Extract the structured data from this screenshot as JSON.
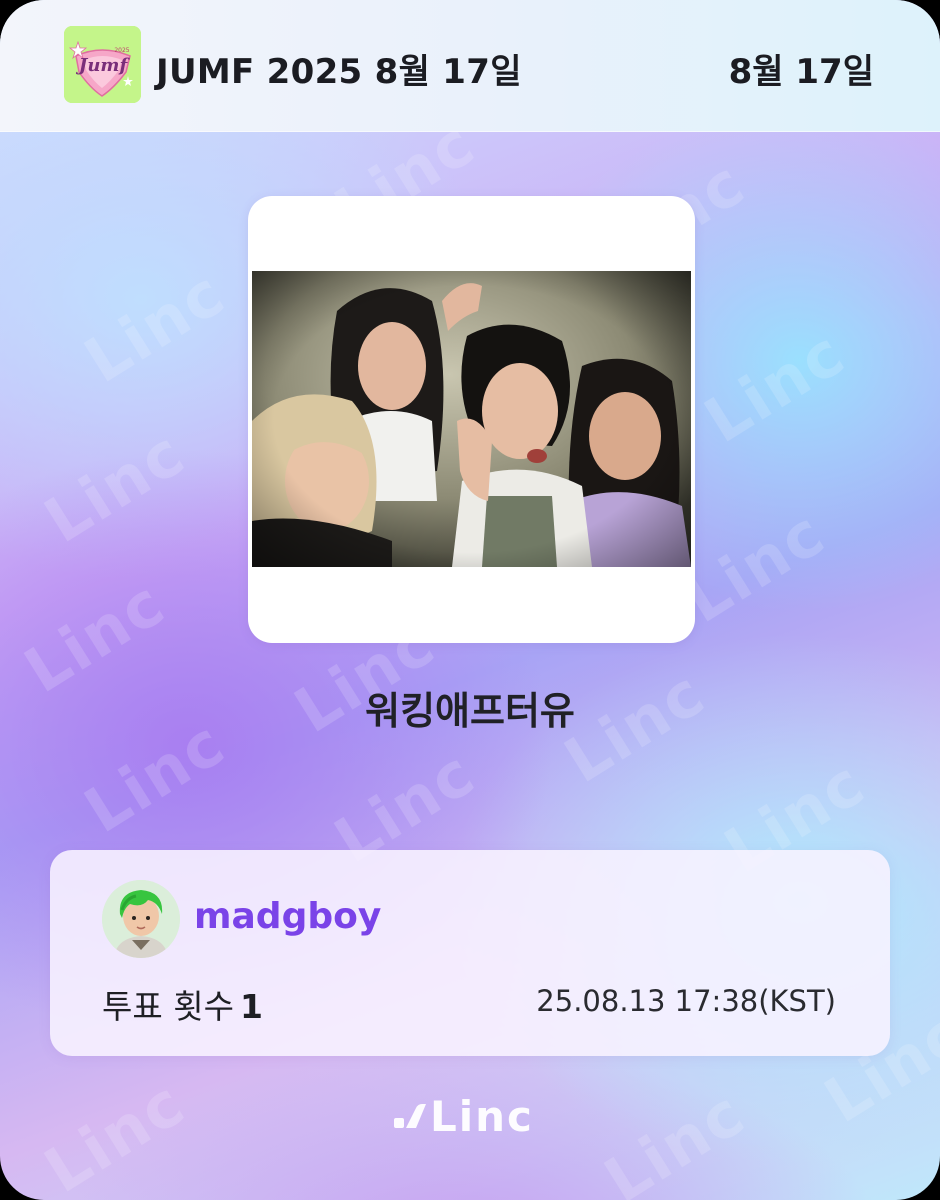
{
  "header": {
    "title": "JUMF 2025 8월 17일",
    "date": "8월 17일",
    "logo_text": "Jumf",
    "logo_year": "2025"
  },
  "artist": {
    "name": "워킹애프터유",
    "photo_icon": "group-photo"
  },
  "vote": {
    "username": "madgboy",
    "count_label": "투표 횟수",
    "count_value": "1",
    "timestamp": "25.08.13 17:38(KST)",
    "avatar_icon": "user-avatar-icon"
  },
  "footer": {
    "brand": "Linc"
  },
  "watermark_text": "Linc",
  "colors": {
    "username": "#7a43e8",
    "logo_badge": "#b9f07a",
    "text_dark": "#1b1c22"
  }
}
